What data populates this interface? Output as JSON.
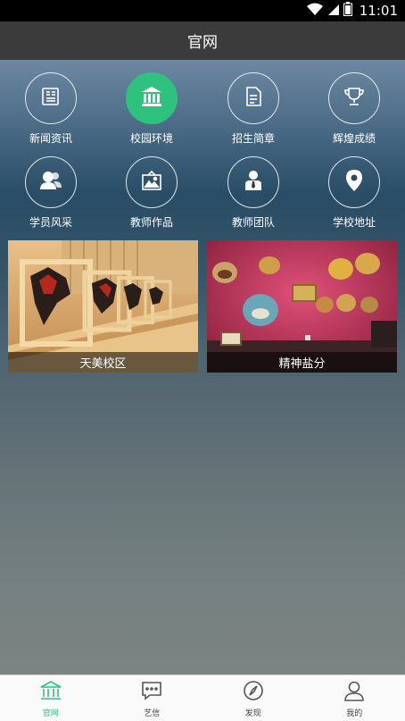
{
  "status_bar": {
    "time": "11:01",
    "icons": [
      "wifi-icon",
      "signal-icon",
      "battery-icon"
    ]
  },
  "header": {
    "title": "官网"
  },
  "grid": {
    "items": [
      {
        "label": "新闻资讯",
        "icon": "newspaper-icon"
      },
      {
        "label": "校园环境",
        "icon": "building-icon",
        "active": true
      },
      {
        "label": "招生简章",
        "icon": "document-icon"
      },
      {
        "label": "辉煌成绩",
        "icon": "trophy-icon"
      },
      {
        "label": "学员风采",
        "icon": "students-icon"
      },
      {
        "label": "教师作品",
        "icon": "picture-icon"
      },
      {
        "label": "教师团队",
        "icon": "teacher-icon"
      },
      {
        "label": "学校地址",
        "icon": "location-icon"
      }
    ]
  },
  "cards": [
    {
      "caption": "天美校区"
    },
    {
      "caption": "精神盐分"
    }
  ],
  "tabs": [
    {
      "label": "官网",
      "icon": "building-icon",
      "active": true
    },
    {
      "label": "艺信",
      "icon": "chat-icon"
    },
    {
      "label": "发现",
      "icon": "compass-icon"
    },
    {
      "label": "我的",
      "icon": "user-icon"
    }
  ],
  "colors": {
    "accent": "#2ec27e",
    "header": "#3b3b3b"
  }
}
